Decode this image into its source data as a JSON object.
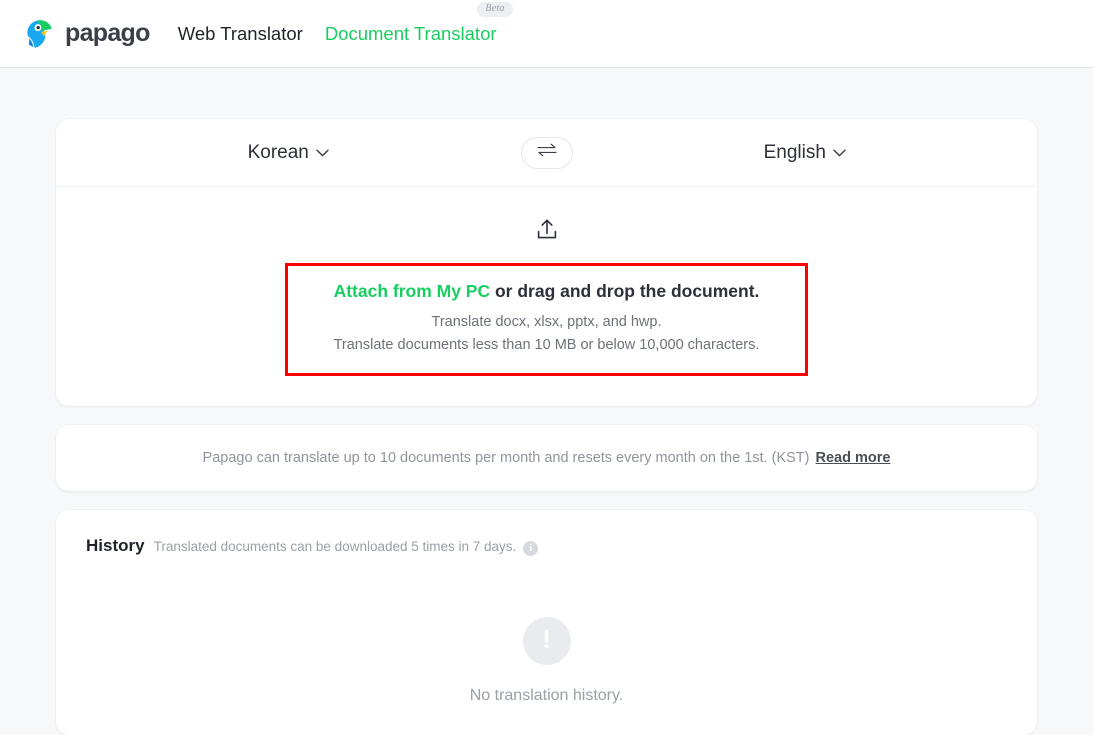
{
  "header": {
    "brand_name": "papago",
    "brand_icon": "papago-parrot-logo",
    "nav": [
      {
        "label": "Web Translator",
        "active": false,
        "badge": null
      },
      {
        "label": "Document Translator",
        "active": true,
        "badge": "Beta"
      }
    ]
  },
  "translator": {
    "source_language": "Korean",
    "target_language": "English",
    "swap_icon": "swap-arrows-icon",
    "chevron_icon": "chevron-down-icon",
    "dropzone": {
      "upload_icon": "upload-icon",
      "attach_link": "Attach from My PC",
      "attach_rest": " or drag and drop the document.",
      "sub_line_1": "Translate docx, xlsx, pptx, and hwp.",
      "sub_line_2": "Translate documents less than 10 MB or below 10,000 characters.",
      "highlight_color": "#fe0000"
    }
  },
  "notice": {
    "text": "Papago can translate up to 10 documents per month and resets every month on the 1st. (KST)",
    "read_more": "Read more"
  },
  "history": {
    "title": "History",
    "description": "Translated documents can be downloaded 5 times in 7 days.",
    "info_icon": "info-icon",
    "info_glyph": "i",
    "empty_icon": "exclamation-circle-icon",
    "empty_glyph": "!",
    "empty_text": "No translation history."
  },
  "colors": {
    "brand_green": "#19ce60",
    "page_background": "#f7f8fa",
    "card_background": "#ffffff",
    "annotation_red": "#fe0000"
  }
}
